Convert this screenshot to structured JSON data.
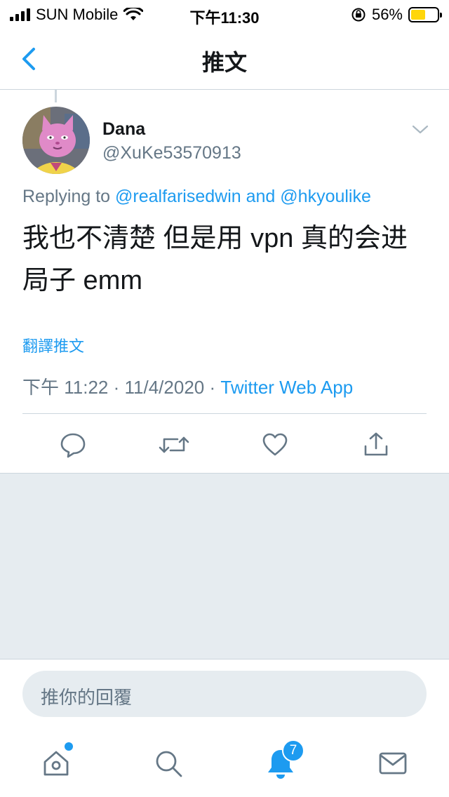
{
  "status_bar": {
    "carrier": "SUN Mobile",
    "time": "下午11:30",
    "battery_percent": "56%",
    "battery_level": 0.56
  },
  "nav": {
    "title": "推文",
    "back_icon": "chevron-left-icon"
  },
  "tweet": {
    "display_name": "Dana",
    "handle": "@XuKe53570913",
    "replying_prefix": "Replying to",
    "mention_1": "@realfarisedwin",
    "conjunction": "and",
    "mention_2": "@hkyoulike",
    "text": "我也不清楚 但是用 vpn 真的会进局子 emm",
    "translate_label": "翻譯推文",
    "time": "下午 11:22",
    "date": "11/4/2020",
    "separator": "·",
    "source": "Twitter Web App"
  },
  "actions": {
    "reply_icon": "reply-icon",
    "retweet_icon": "retweet-icon",
    "like_icon": "heart-icon",
    "share_icon": "share-icon"
  },
  "reply_box": {
    "placeholder": "推你的回覆"
  },
  "tab_bar": {
    "home_icon": "home-icon",
    "search_icon": "search-icon",
    "notifications_icon": "bell-icon",
    "notifications_count": "7",
    "messages_icon": "mail-icon"
  },
  "colors": {
    "accent": "#1d9bf0",
    "secondary_text": "#657786",
    "divider": "#ccd6dd",
    "background_gray": "#e6ecf0"
  }
}
